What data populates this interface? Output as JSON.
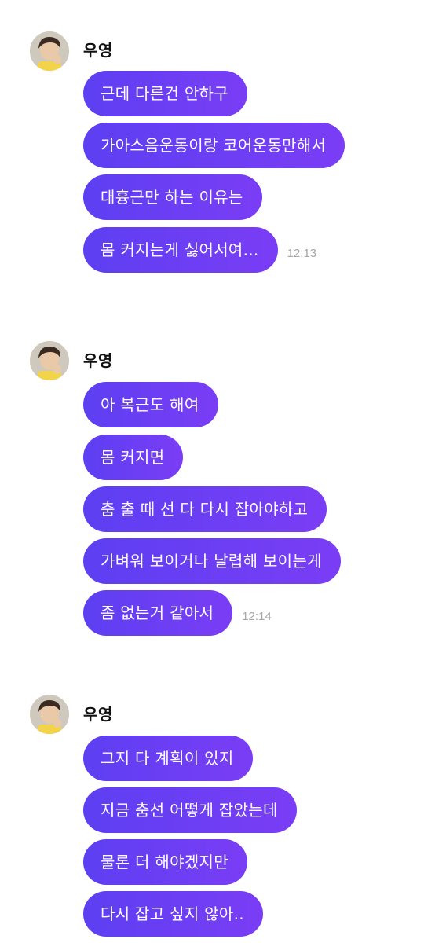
{
  "colors": {
    "bubble_start": "#5d3ff2",
    "bubble_end": "#7a3df5",
    "bubble_text": "#ffffff",
    "timestamp": "#a6a6a6",
    "background": "#ffffff"
  },
  "groups": [
    {
      "sender": "우영",
      "avatar": "profile-photo-icon",
      "messages": [
        {
          "text": "근데 다른건 안하구",
          "time": ""
        },
        {
          "text": "가아스음운동이랑 코어운동만해서",
          "time": ""
        },
        {
          "text": "대흉근만 하는 이유는",
          "time": ""
        },
        {
          "text": "몸 커지는게 싫어서여...",
          "time": "12:13"
        }
      ]
    },
    {
      "sender": "우영",
      "avatar": "profile-photo-icon",
      "messages": [
        {
          "text": "아 복근도 해여",
          "time": ""
        },
        {
          "text": "몸 커지면",
          "time": ""
        },
        {
          "text": "춤 출 때 선 다 다시 잡아야하고",
          "time": ""
        },
        {
          "text": "가벼워 보이거나 날렵해 보이는게",
          "time": ""
        },
        {
          "text": "좀 없는거 같아서",
          "time": "12:14"
        }
      ]
    },
    {
      "sender": "우영",
      "avatar": "profile-photo-icon",
      "messages": [
        {
          "text": "그지 다 계획이 있지",
          "time": ""
        },
        {
          "text": "지금 춤선 어떻게 잡았는데",
          "time": ""
        },
        {
          "text": "물론 더 해야겠지만",
          "time": ""
        },
        {
          "text": "다시 잡고 싶지 않아..",
          "time": ""
        }
      ]
    }
  ]
}
